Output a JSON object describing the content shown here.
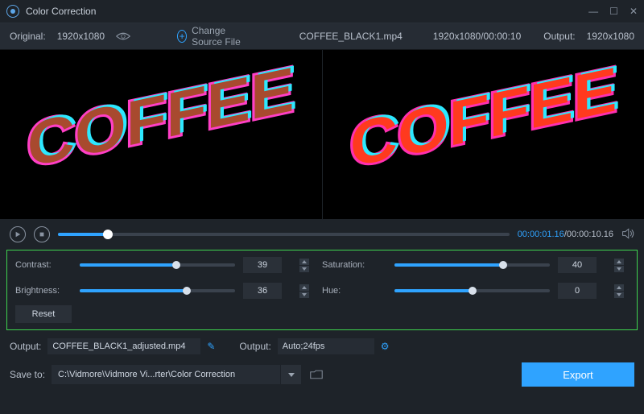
{
  "window": {
    "title": "Color Correction"
  },
  "toolbar": {
    "original_label": "Original:",
    "original_res": "1920x1080",
    "change_source": "Change Source File",
    "filename": "COFFEE_BLACK1.mp4",
    "resolution": "1920x1080",
    "duration": "00:00:10",
    "output_label": "Output:",
    "output_res": "1920x1080"
  },
  "transport": {
    "current_time": "00:00:01.16",
    "total_time": "00:00:10.16",
    "progress_pct": 11
  },
  "controls": {
    "contrast": {
      "label": "Contrast:",
      "value": 39,
      "pct": 62
    },
    "brightness": {
      "label": "Brightness:",
      "value": 36,
      "pct": 69
    },
    "saturation": {
      "label": "Saturation:",
      "value": 40,
      "pct": 70
    },
    "hue": {
      "label": "Hue:",
      "value": 0,
      "pct": 50
    },
    "reset": "Reset"
  },
  "output": {
    "label1": "Output:",
    "filename": "COFFEE_BLACK1_adjusted.mp4",
    "label2": "Output:",
    "format": "Auto;24fps",
    "save_to_label": "Save to:",
    "save_path": "C:\\Vidmore\\Vidmore Vi...rter\\Color Correction",
    "export": "Export"
  }
}
